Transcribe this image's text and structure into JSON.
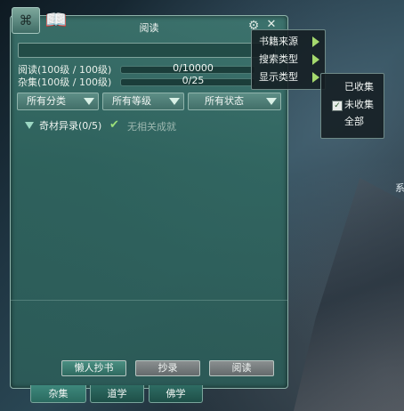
{
  "window": {
    "title": "阅读",
    "close_label": "✕",
    "gear_glyph": "⚙"
  },
  "toolbar_icons": [
    "command-icon",
    "book-icon"
  ],
  "search": {
    "value": "",
    "placeholder": ""
  },
  "stats": [
    {
      "label": "阅读(100级 / 100级)",
      "value": "0/10000"
    },
    {
      "label": "杂集(100级 / 100级)",
      "value": "0/25"
    }
  ],
  "filters": [
    {
      "label": "所有分类"
    },
    {
      "label": "所有等级"
    },
    {
      "label": "所有状态"
    }
  ],
  "tree": {
    "group_label": "奇材异录(0/5)",
    "note": "无相关成就"
  },
  "bottom_buttons": [
    {
      "label": "懒人抄书"
    },
    {
      "label": "抄录"
    },
    {
      "label": "阅读"
    }
  ],
  "tabs": [
    {
      "label": "杂集"
    },
    {
      "label": "道学"
    },
    {
      "label": "佛学"
    }
  ],
  "menu": {
    "items": [
      {
        "label": "书籍来源"
      },
      {
        "label": "搜索类型"
      },
      {
        "label": "显示类型"
      }
    ]
  },
  "submenu": {
    "items": [
      {
        "label": "已收集",
        "checked": false
      },
      {
        "label": "未收集",
        "checked": true
      },
      {
        "label": "全部",
        "checked": false
      }
    ]
  },
  "edge_text": "系",
  "colors": {
    "panel": "#3e786f",
    "accent_arrow": "#a5d96e",
    "button_active": "#3a7f72",
    "button_gray": "#787e80"
  }
}
